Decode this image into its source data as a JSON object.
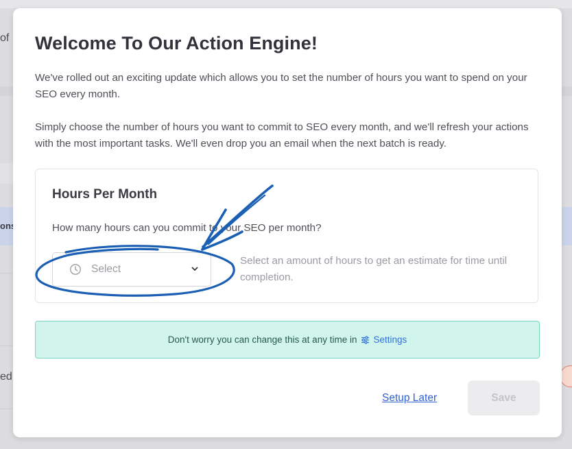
{
  "background": {
    "fragment_top": "of",
    "fragment_mid": "ons",
    "fragment_bottom": "ed"
  },
  "modal": {
    "title": "Welcome To Our Action Engine!",
    "paragraph1": "We've rolled out an exciting update which allows you to set the number of hours you want to spend on your SEO every month.",
    "paragraph2": "Simply choose the number of hours you want to commit to SEO every month, and we'll refresh your actions with the most important tasks. We'll even drop you an email when the next batch is ready."
  },
  "hours_card": {
    "title": "Hours Per Month",
    "question": "How many hours can you commit to your SEO per month?",
    "select": {
      "placeholder": "Select",
      "icon": "clock-icon",
      "chevron": "chevron-down-icon"
    },
    "hint": "Select an amount of hours to get an estimate for time until completion."
  },
  "notice": {
    "text": "Don't worry you can change this at any time in",
    "link_label": "Settings",
    "link_icon": "sliders-icon"
  },
  "footer": {
    "setup_later_label": "Setup Later",
    "save_label": "Save"
  },
  "colors": {
    "annotation": "#1a5fb4",
    "notice_bg": "#d1f5ec",
    "notice_border": "#7fd6bf",
    "link": "#2f5fd6"
  }
}
